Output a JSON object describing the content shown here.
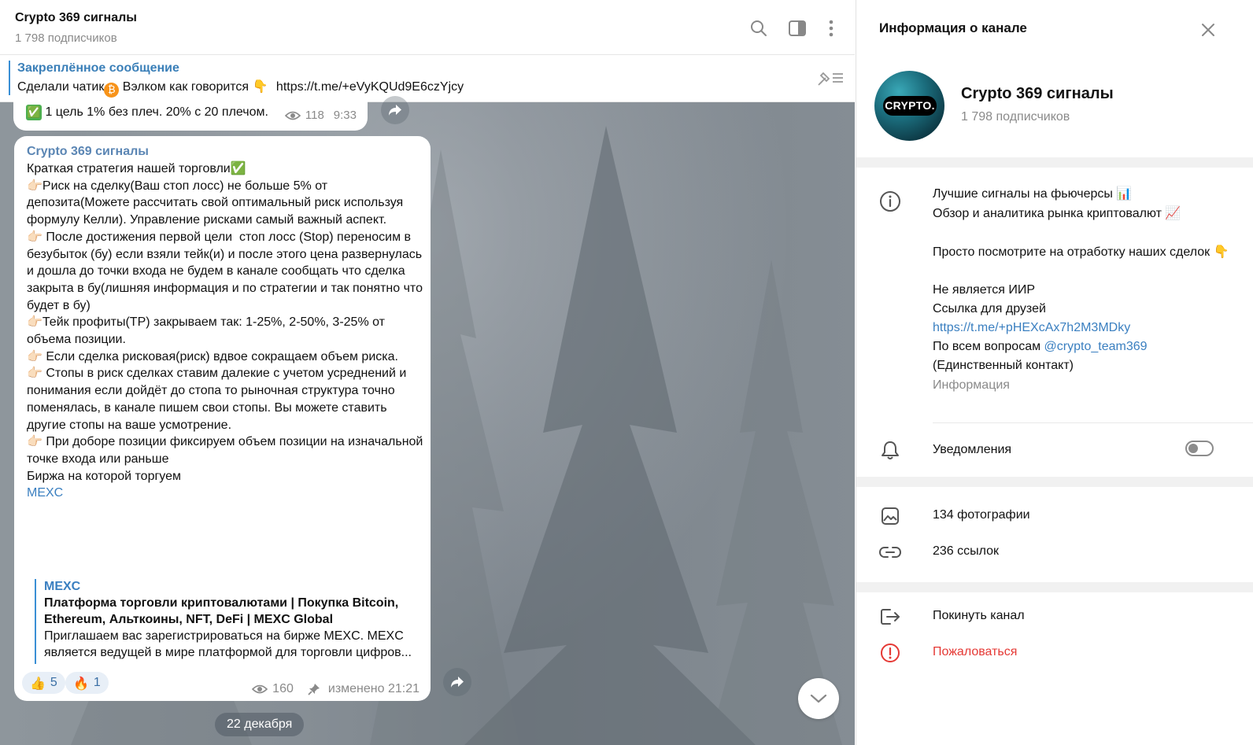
{
  "chat": {
    "title": "Crypto 369 сигналы",
    "subscribers": "1 798 подписчиков",
    "pinned": {
      "label": "Закреплённое сообщение",
      "text_prefix": "Сделали чатик",
      "emoji_coin": "₿",
      "text_middle": " Вэлком как говорится",
      "emoji_hand": "👇",
      "link": "https://t.me/+eVyKQUd9E6czYjcy"
    },
    "prev_message": {
      "check": "✅",
      "text": "1 цель 1% без плеч. 20% с 20 плечом.",
      "views": "118",
      "time": "9:33"
    },
    "message": {
      "author": "Crypto 369 сигналы",
      "lines": [
        "Краткая стратегия нашей торговли✅",
        "",
        "👉🏻Риск на сделку(Ваш стоп лосс) не больше 5% от депозита(Можете рассчитать свой оптимальный риск используя формулу Келли). Управление рисками самый важный аспект.",
        "👉🏻 После достижения первой цели  стоп лосс (Stop) переносим в безубыток (бу) если взяли тейк(и) и после этого цена развернулась и дошла до точки входа не будем в канале сообщать что сделка закрыта в бу(лишняя информация и по стратегии и так понятно что будет в бу)",
        "👉🏻Тейк профиты(TP) закрываем так: 1-25%, 2-50%, 3-25% от объема позиции.",
        "👉🏻 Если сделка рисковая(риск) вдвое сокращаем объем риска.",
        "👉🏻 Стопы в риск сделках ставим далекие с учетом усреднений и понимания если дойдёт до стопа то рыночная структура точно поменялась, в канале пишем свои стопы. Вы можете ставить другие стопы на ваше усмотрение.",
        "👉🏻 При доборе позиции фиксируем объем позиции на изначальной точке входа или раньше",
        "",
        "Биржа на которой торгуем",
        ""
      ],
      "link": "MEXC",
      "preview": {
        "site": "MEXC",
        "title": "Платформа торговли криптовалютами | Покупка Bitcoin, Ethereum, Альткоины, NFT, DeFi | MEXC Global",
        "description": "Приглашаем вас зарегистрироваться на бирже MEXC. MEXC является ведущей в мире платформой для торговли цифров..."
      },
      "reactions": [
        {
          "emoji": "👍",
          "count": "5"
        },
        {
          "emoji": "🔥",
          "count": "1"
        }
      ],
      "views": "160",
      "edited": "изменено 21:21"
    },
    "date_chip": "22 декабря"
  },
  "panel": {
    "title": "Информация о канале",
    "avatar_text": "CRYPTO.",
    "name": "Crypto 369 сигналы",
    "subscribers": "1 798 подписчиков",
    "description": {
      "line1": "Лучшие сигналы на фьючерсы",
      "line1_emoji": "📊",
      "line2": "Обзор и аналитика рынка криптовалют",
      "line2_emoji": "📈",
      "line3": "Просто посмотрите на отработку наших сделок",
      "line3_emoji": "👇",
      "line4": "Не является ИИР",
      "line5": "Ссылка для друзей",
      "link": "https://t.me/+pHEXcAx7h2M3MDky",
      "contact_prefix": "По всем вопросам ",
      "contact_handle": "@crypto_team369",
      "contact_note": "(Единственный контакт)",
      "caption": "Информация"
    },
    "notifications_label": "Уведомления",
    "notifications_on": false,
    "photos": "134 фотографии",
    "links": "236 ссылок",
    "leave": "Покинуть канал",
    "report": "Пожаловаться"
  },
  "colors": {
    "accent": "#3a7fc0",
    "danger": "#e53935",
    "muted": "#8a8a8a"
  }
}
